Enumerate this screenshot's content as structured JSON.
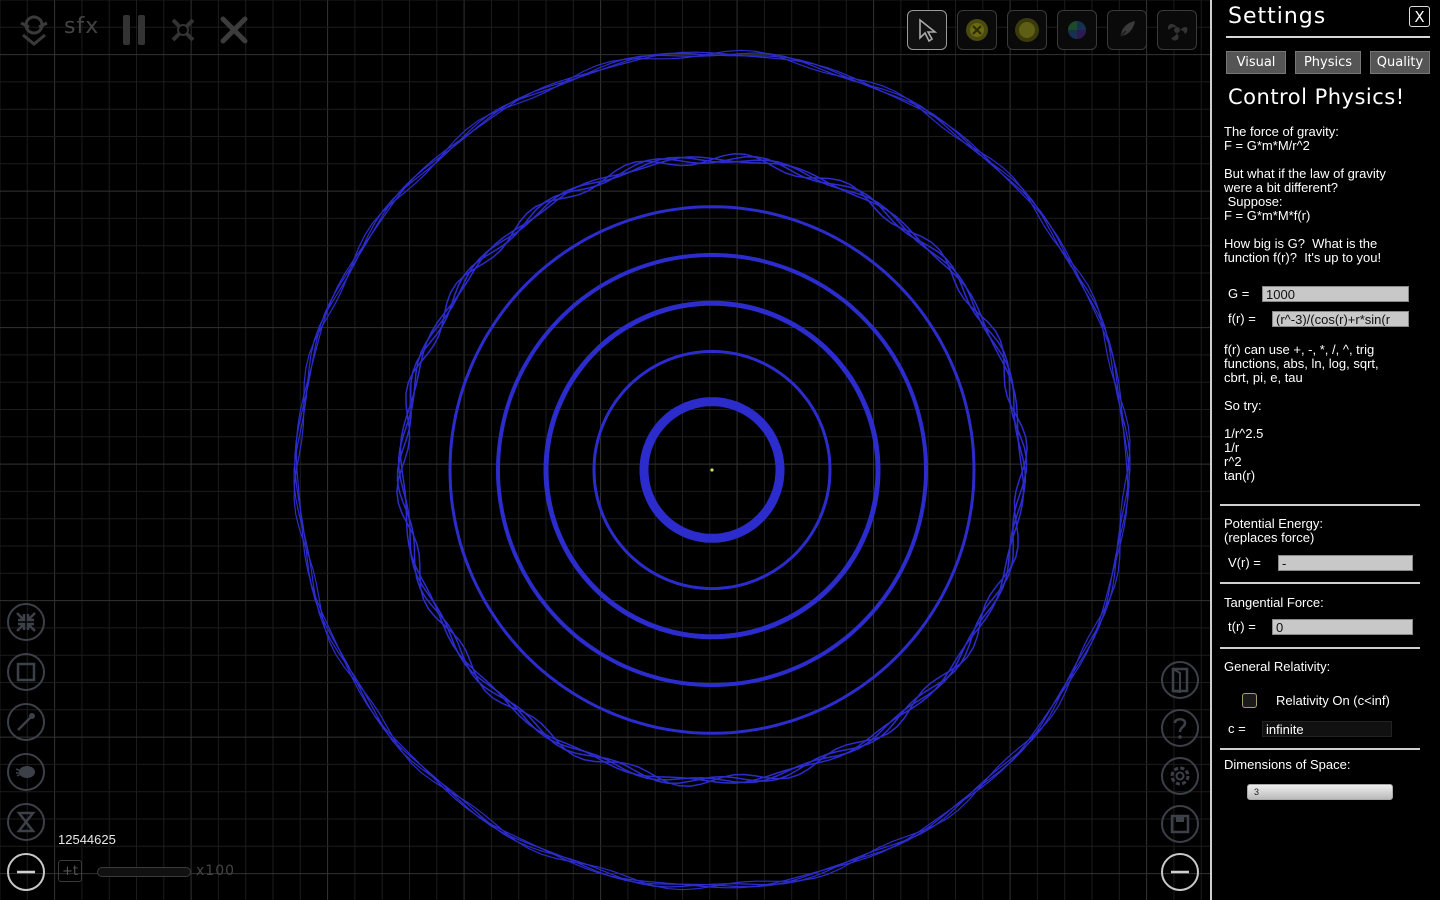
{
  "toolbar": {
    "sfx_label": "sfx",
    "tools": [
      {
        "name": "cursor-tool",
        "icon": "cursor-icon",
        "active": true
      },
      {
        "name": "star-tool",
        "icon": "star-yellow-icon"
      },
      {
        "name": "sun-tool",
        "icon": "sun-icon"
      },
      {
        "name": "planet-tool",
        "icon": "planet-icon"
      },
      {
        "name": "comet-tool",
        "icon": "comet-icon"
      },
      {
        "name": "galaxy-tool",
        "icon": "galaxy-icon"
      }
    ]
  },
  "simulation": {
    "counter": "12544625",
    "time_step_label": "+t",
    "speed_label": "x100",
    "orbit_color": "#2c2ccc"
  },
  "settings": {
    "title": "Settings",
    "close_label": "X",
    "tabs": [
      {
        "label": "Visual"
      },
      {
        "label": "Physics"
      },
      {
        "label": "Quality"
      }
    ],
    "heading": "Control Physics!",
    "intro_1": "The force of gravity:\nF = G*m*M/r^2",
    "intro_2": "But what if the law of gravity\nwere a bit different?\n Suppose:\nF = G*m*M*f(r)",
    "intro_3": "How big is G?  What is the\nfunction f(r)?  It's up to you!",
    "g_label": "G =",
    "g_value": "1000",
    "f_label": "f(r) =",
    "f_value": "(r^-3)/(cos(r)+r*sin(r",
    "f_help": "f(r) can use +, -, *, /, ^, trig\nfunctions, abs, ln, log, sqrt,\ncbrt, pi, e, tau",
    "try_label": "So try:",
    "try_list": "1/r^2.5\n1/r\nr^2\ntan(r)",
    "pe_label": "Potential Energy:\n(replaces force)",
    "v_label": "V(r) =",
    "v_value": "-",
    "tf_label": "Tangential Force:",
    "t_label": "t(r) =",
    "t_value": "0",
    "gr_label": "General Relativity:",
    "relativity_label": "Relativity On (c<inf)",
    "c_label": "c =",
    "c_value": "infinite",
    "dim_label": "Dimensions of Space:",
    "dim_value": "3"
  }
}
